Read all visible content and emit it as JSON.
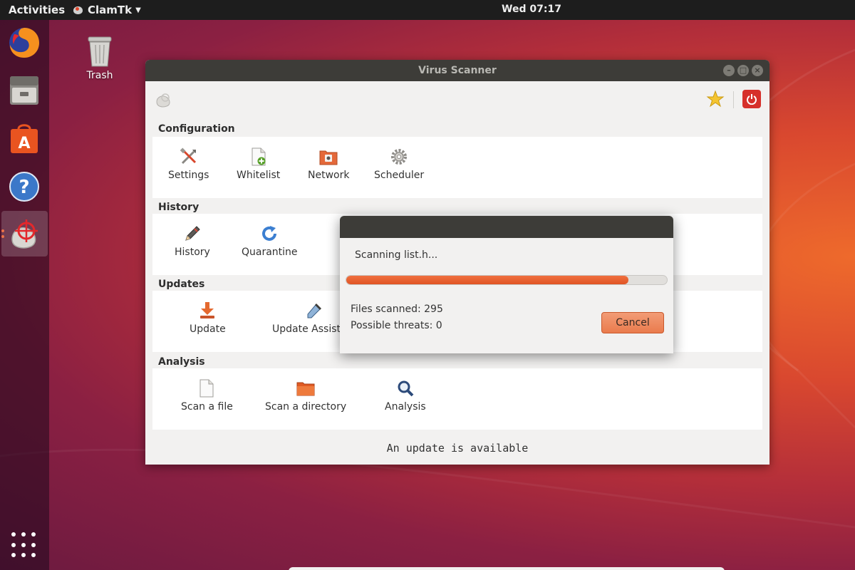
{
  "topbar": {
    "activities": "Activities",
    "app_name": "ClamTk",
    "clock": "Wed 07:17"
  },
  "dock": {
    "items": [
      {
        "icon": "firefox-icon"
      },
      {
        "icon": "files-icon"
      },
      {
        "icon": "software-center-icon"
      },
      {
        "icon": "help-icon"
      },
      {
        "icon": "clamtk-icon",
        "active": true
      }
    ],
    "show_apps_icon": "apps-grid-icon"
  },
  "desktop": {
    "trash_label": "Trash"
  },
  "window": {
    "title": "Virus Scanner",
    "sections": {
      "configuration": {
        "label": "Configuration",
        "items": [
          {
            "label": "Settings",
            "icon": "settings-tools-icon"
          },
          {
            "label": "Whitelist",
            "icon": "whitelist-document-icon"
          },
          {
            "label": "Network",
            "icon": "network-icon"
          },
          {
            "label": "Scheduler",
            "icon": "scheduler-gear-icon"
          }
        ]
      },
      "history": {
        "label": "History",
        "items": [
          {
            "label": "History",
            "icon": "pencil-icon"
          },
          {
            "label": "Quarantine",
            "icon": "refresh-icon"
          }
        ]
      },
      "updates": {
        "label": "Updates",
        "items": [
          {
            "label": "Update",
            "icon": "download-icon"
          },
          {
            "label": "Update Assistant",
            "icon": "dropper-icon"
          }
        ]
      },
      "analysis": {
        "label": "Analysis",
        "items": [
          {
            "label": "Scan a file",
            "icon": "file-icon"
          },
          {
            "label": "Scan a directory",
            "icon": "folder-icon"
          },
          {
            "label": "Analysis",
            "icon": "magnifier-icon"
          }
        ]
      }
    },
    "status": "An update is available"
  },
  "scan_dialog": {
    "message": "Scanning list.h...",
    "progress_fraction": 0.88,
    "files_scanned": "Files scanned: 295",
    "possible_threats": "Possible threats: 0",
    "cancel_label": "Cancel"
  },
  "colors": {
    "accent": "#e95420",
    "titlebar": "#3d3c38",
    "window_bg": "#f2f1f0"
  }
}
